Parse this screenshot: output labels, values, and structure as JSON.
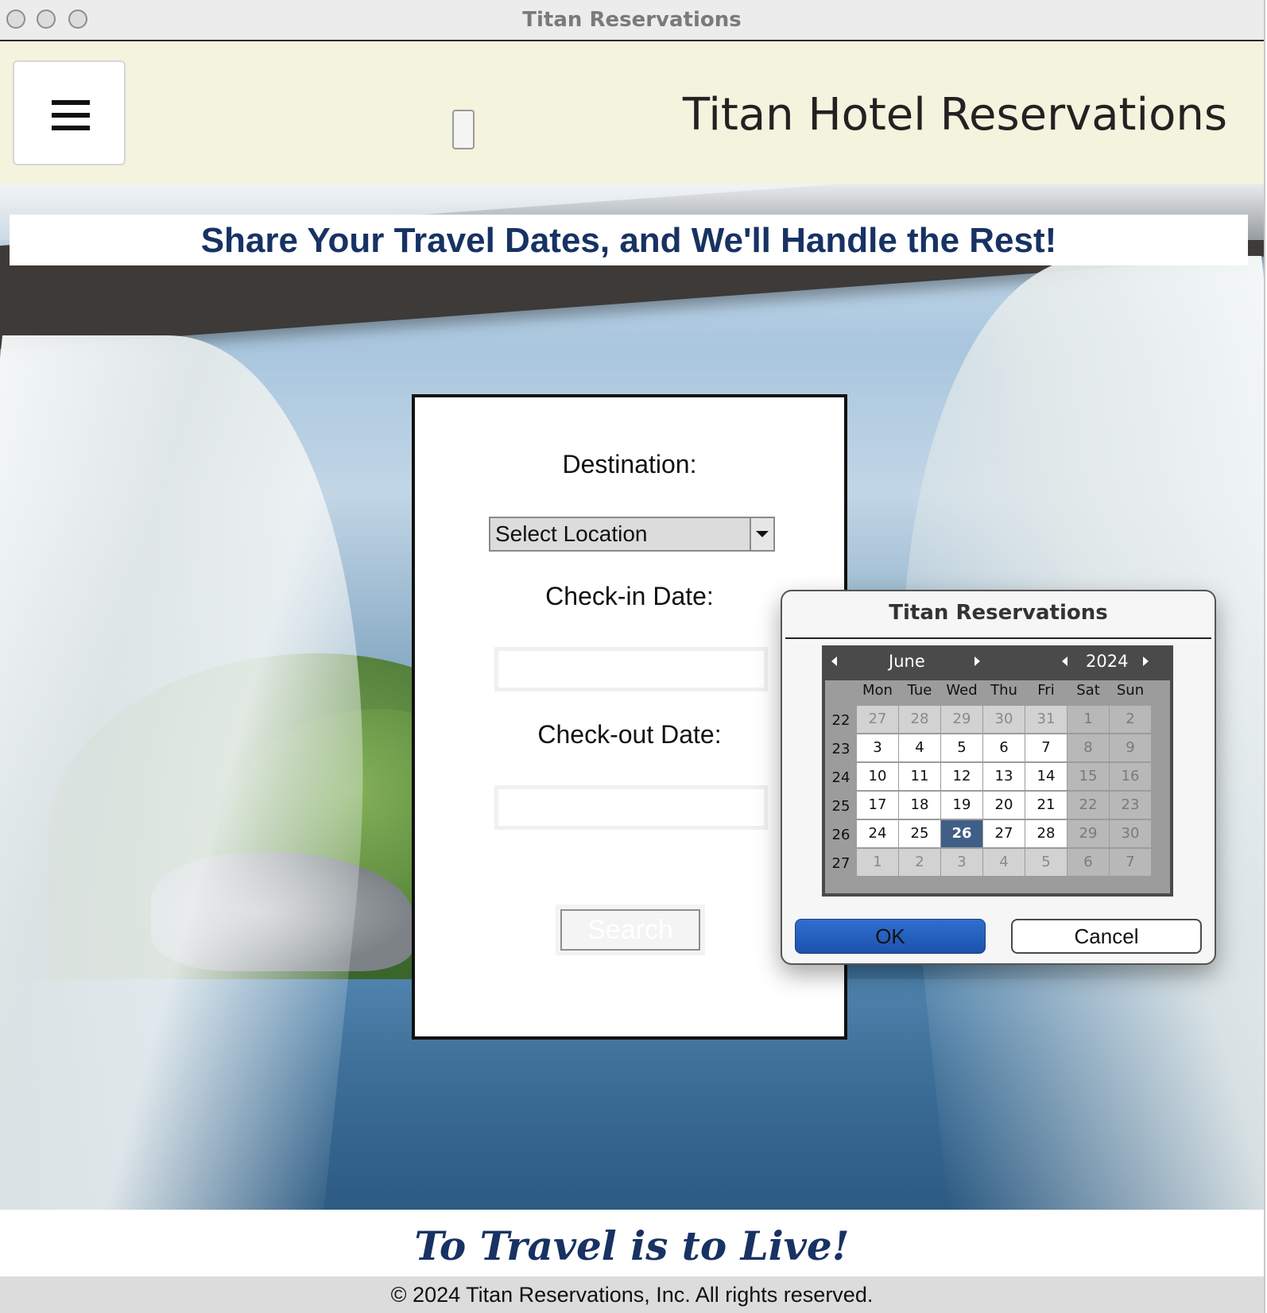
{
  "window": {
    "title": "Titan Reservations"
  },
  "header": {
    "brand": "Titan Hotel Reservations"
  },
  "hero": {
    "tagline": "Share Your Travel Dates, and We'll Handle the Rest!"
  },
  "form": {
    "destination_label": "Destination:",
    "destination_value": "Select Location",
    "checkin_label": "Check-in Date:",
    "checkin_value": "",
    "checkout_label": "Check-out Date:",
    "checkout_value": "",
    "search_label": "Search"
  },
  "dialog": {
    "title": "Titan Reservations",
    "month": "June",
    "year": "2024",
    "weekdays": [
      "Mon",
      "Tue",
      "Wed",
      "Thu",
      "Fri",
      "Sat",
      "Sun"
    ],
    "weeks": [
      {
        "num": "22",
        "days": [
          "27",
          "28",
          "29",
          "30",
          "31",
          "1",
          "2"
        ]
      },
      {
        "num": "23",
        "days": [
          "3",
          "4",
          "5",
          "6",
          "7",
          "8",
          "9"
        ]
      },
      {
        "num": "24",
        "days": [
          "10",
          "11",
          "12",
          "13",
          "14",
          "15",
          "16"
        ]
      },
      {
        "num": "25",
        "days": [
          "17",
          "18",
          "19",
          "20",
          "21",
          "22",
          "23"
        ]
      },
      {
        "num": "26",
        "days": [
          "24",
          "25",
          "26",
          "27",
          "28",
          "29",
          "30"
        ]
      },
      {
        "num": "27",
        "days": [
          "1",
          "2",
          "3",
          "4",
          "5",
          "6",
          "7"
        ]
      }
    ],
    "selected_day": "26",
    "ok_label": "OK",
    "cancel_label": "Cancel"
  },
  "footer": {
    "slogan": "To Travel is to Live!",
    "copyright": "© 2024 Titan Reservations, Inc. All rights reserved."
  },
  "colors": {
    "header_bg": "#f3f3de",
    "accent_navy": "#173263",
    "ok_blue": "#2f6fcf",
    "selected_day": "#3f5f86"
  }
}
